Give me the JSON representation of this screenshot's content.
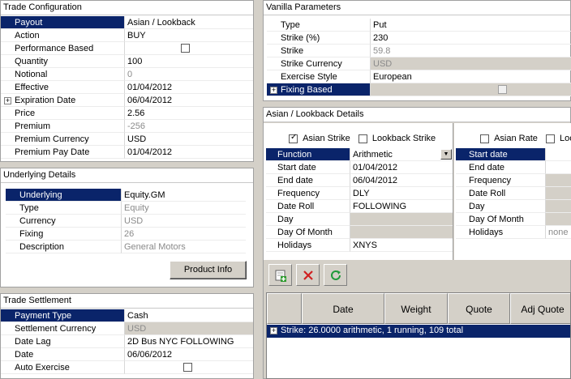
{
  "trade_config": {
    "title": "Trade Configuration",
    "rows": [
      {
        "label": "Payout",
        "value": "Asian / Lookback"
      },
      {
        "label": "Action",
        "value": "BUY"
      },
      {
        "label": "Performance Based",
        "value": ""
      },
      {
        "label": "Quantity",
        "value": "100"
      },
      {
        "label": "Notional",
        "value": "0"
      },
      {
        "label": "Effective",
        "value": "01/04/2012"
      },
      {
        "label": "Expiration Date",
        "value": "06/04/2012"
      },
      {
        "label": "Price",
        "value": "2.56"
      },
      {
        "label": "Premium",
        "value": "-256"
      },
      {
        "label": "Premium Currency",
        "value": "USD"
      },
      {
        "label": "Premium Pay Date",
        "value": "01/04/2012"
      }
    ]
  },
  "underlying": {
    "title": "Underlying Details",
    "rows": [
      {
        "label": "Underlying",
        "value": "Equity.GM"
      },
      {
        "label": "Type",
        "value": "Equity"
      },
      {
        "label": "Currency",
        "value": "USD"
      },
      {
        "label": "Fixing",
        "value": "26"
      },
      {
        "label": "Description",
        "value": "General Motors"
      }
    ],
    "product_info_label": "Product Info"
  },
  "settlement": {
    "title": "Trade Settlement",
    "rows": [
      {
        "label": "Payment Type",
        "value": "Cash"
      },
      {
        "label": "Settlement Currency",
        "value": "USD"
      },
      {
        "label": "Date Lag",
        "value": "2D Bus NYC FOLLOWING"
      },
      {
        "label": "Date",
        "value": "06/06/2012"
      },
      {
        "label": "Auto Exercise",
        "value": ""
      }
    ]
  },
  "vanilla": {
    "title": "Vanilla Parameters",
    "rows": [
      {
        "label": "Type",
        "value": "Put"
      },
      {
        "label": "Strike (%)",
        "value": "230"
      },
      {
        "label": "Strike",
        "value": "59.8"
      },
      {
        "label": "Strike Currency",
        "value": "USD"
      },
      {
        "label": "Exercise Style",
        "value": "European"
      },
      {
        "label": "Fixing Based",
        "value": ""
      }
    ]
  },
  "asian": {
    "title": "Asian / Lookback Details",
    "asian_strike_label": "Asian Strike",
    "lookback_strike_label": "Lookback Strike",
    "asian_rate_label": "Asian Rate",
    "lookback_rate_label": "Look",
    "strike_rows": [
      {
        "label": "Function",
        "value": "Arithmetic"
      },
      {
        "label": "Start date",
        "value": "01/04/2012"
      },
      {
        "label": "End date",
        "value": "06/04/2012"
      },
      {
        "label": "Frequency",
        "value": "DLY"
      },
      {
        "label": "Date Roll",
        "value": "FOLLOWING"
      },
      {
        "label": "Day",
        "value": ""
      },
      {
        "label": "Day Of Month",
        "value": ""
      },
      {
        "label": "Holidays",
        "value": "XNYS"
      }
    ],
    "rate_rows": [
      {
        "label": "Start date",
        "value": ""
      },
      {
        "label": "End date",
        "value": ""
      },
      {
        "label": "Frequency",
        "value": ""
      },
      {
        "label": "Date Roll",
        "value": ""
      },
      {
        "label": "Day",
        "value": ""
      },
      {
        "label": "Day Of Month",
        "value": ""
      },
      {
        "label": "Holidays",
        "value": "none"
      }
    ]
  },
  "grid": {
    "columns": [
      "Date",
      "Weight",
      "Quote",
      "Adj Quote"
    ],
    "group_row": "Strike: 26.0000 arithmetic, 1 running, 109 total"
  }
}
